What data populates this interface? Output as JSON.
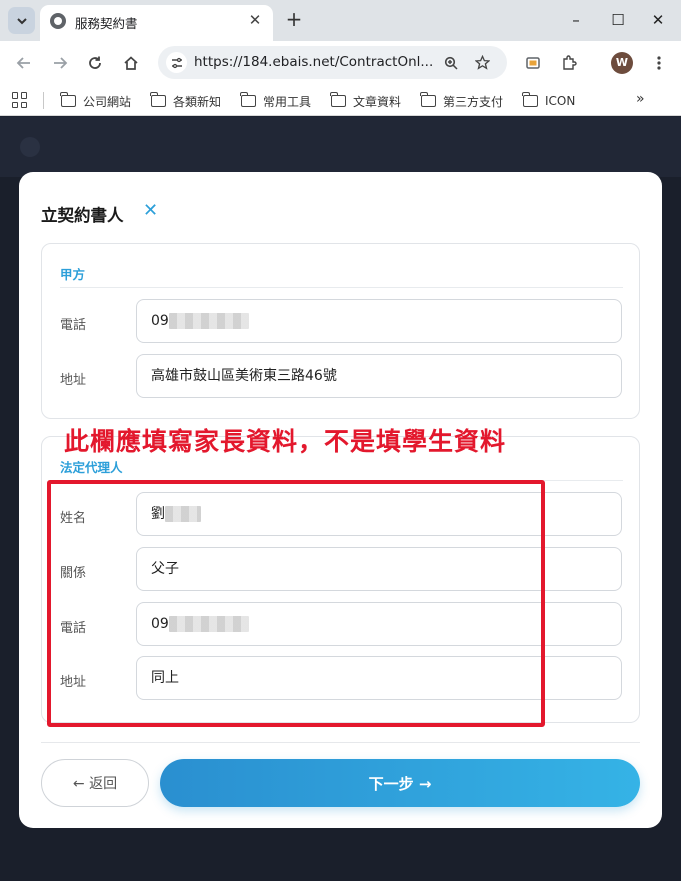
{
  "browser": {
    "tab_title": "服務契約書",
    "tab_close": "✕",
    "new_tab": "+",
    "url": "https://184.ebais.net/ContractOnl...",
    "profile_initial": "W",
    "window_controls": {
      "minimize": "–",
      "maximize": "☐",
      "close": "✕"
    },
    "bookmarks": [
      "公司網站",
      "各類新知",
      "常用工具",
      "文章資料",
      "第三方支付",
      "ICON"
    ],
    "bookmarks_more": "»"
  },
  "modal": {
    "title": "立契約書人",
    "close_label": "✕",
    "party_a": {
      "title": "甲方",
      "phone_label": "電話",
      "phone_value": "09",
      "address_label": "地址",
      "address_value": "高雄市鼓山區美術東三路46號"
    },
    "guardian": {
      "title": "法定代理人",
      "name_label": "姓名",
      "name_value": "劉",
      "relation_label": "關係",
      "relation_value": "父子",
      "phone_label": "電話",
      "phone_value": "09",
      "address_label": "地址",
      "address_value": "同上"
    },
    "back_button": "← 返回",
    "next_button": "下一步 →"
  },
  "annotation": {
    "text": "此欄應填寫家長資料，不是填學生資料",
    "color": "#e3182d"
  },
  "colors": {
    "accent": "#2c9fd9",
    "annotation": "#e3182d"
  }
}
